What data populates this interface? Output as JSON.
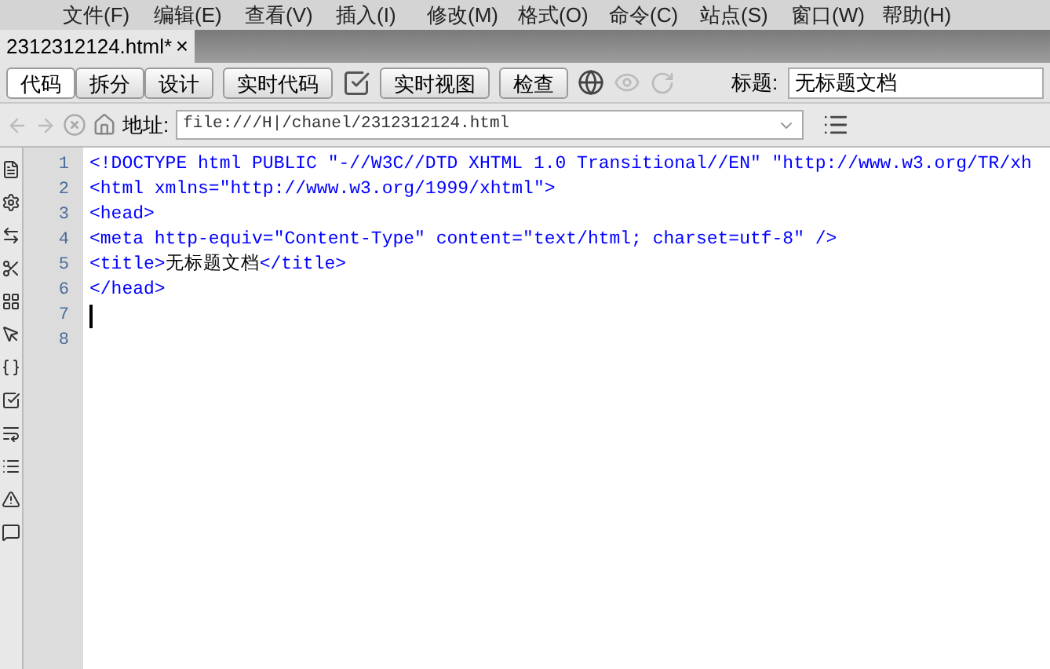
{
  "menu": [
    "文件(F)",
    "编辑(E)",
    "查看(V)",
    "插入(I)",
    "修改(M)",
    "格式(O)",
    "命令(C)",
    "站点(S)",
    "窗口(W)",
    "帮助(H)"
  ],
  "document_tab": {
    "label": "2312312124.html*",
    "close": "×"
  },
  "toolbar": {
    "view_buttons": [
      {
        "label": "代码",
        "selected": true
      },
      {
        "label": "拆分",
        "selected": false
      },
      {
        "label": "设计",
        "selected": false
      }
    ],
    "live_code": "实时代码",
    "live_view": "实时视图",
    "inspect": "检查",
    "title_label": "标题:",
    "title_value": "无标题文档"
  },
  "address_bar": {
    "label": "地址:",
    "value": "file:///H|/chanel/2312312124.html"
  },
  "code": {
    "lines": [
      {
        "number": "1",
        "segments": [
          {
            "kind": "tag",
            "text": "<!DOCTYPE html PUBLIC \"-//W3C//DTD XHTML 1.0 Transitional//EN\" \"http://www.w3.org/TR/xh"
          }
        ]
      },
      {
        "number": "2",
        "segments": [
          {
            "kind": "tag",
            "text": "<html xmlns=\"http://www.w3.org/1999/xhtml\">"
          }
        ]
      },
      {
        "number": "3",
        "segments": [
          {
            "kind": "tag",
            "text": "<head>"
          }
        ]
      },
      {
        "number": "4",
        "segments": [
          {
            "kind": "tag",
            "text": "<meta http-equiv=\"Content-Type\" content=\"text/html; charset=utf-8\" />"
          }
        ]
      },
      {
        "number": "5",
        "segments": [
          {
            "kind": "tag",
            "text": "<title>"
          },
          {
            "kind": "text",
            "text": "无标题文档"
          },
          {
            "kind": "tag",
            "text": "</title>"
          }
        ]
      },
      {
        "number": "6",
        "segments": [
          {
            "kind": "tag",
            "text": "</head>"
          }
        ]
      },
      {
        "number": "7",
        "cursor": true
      },
      {
        "number": "8"
      }
    ]
  }
}
